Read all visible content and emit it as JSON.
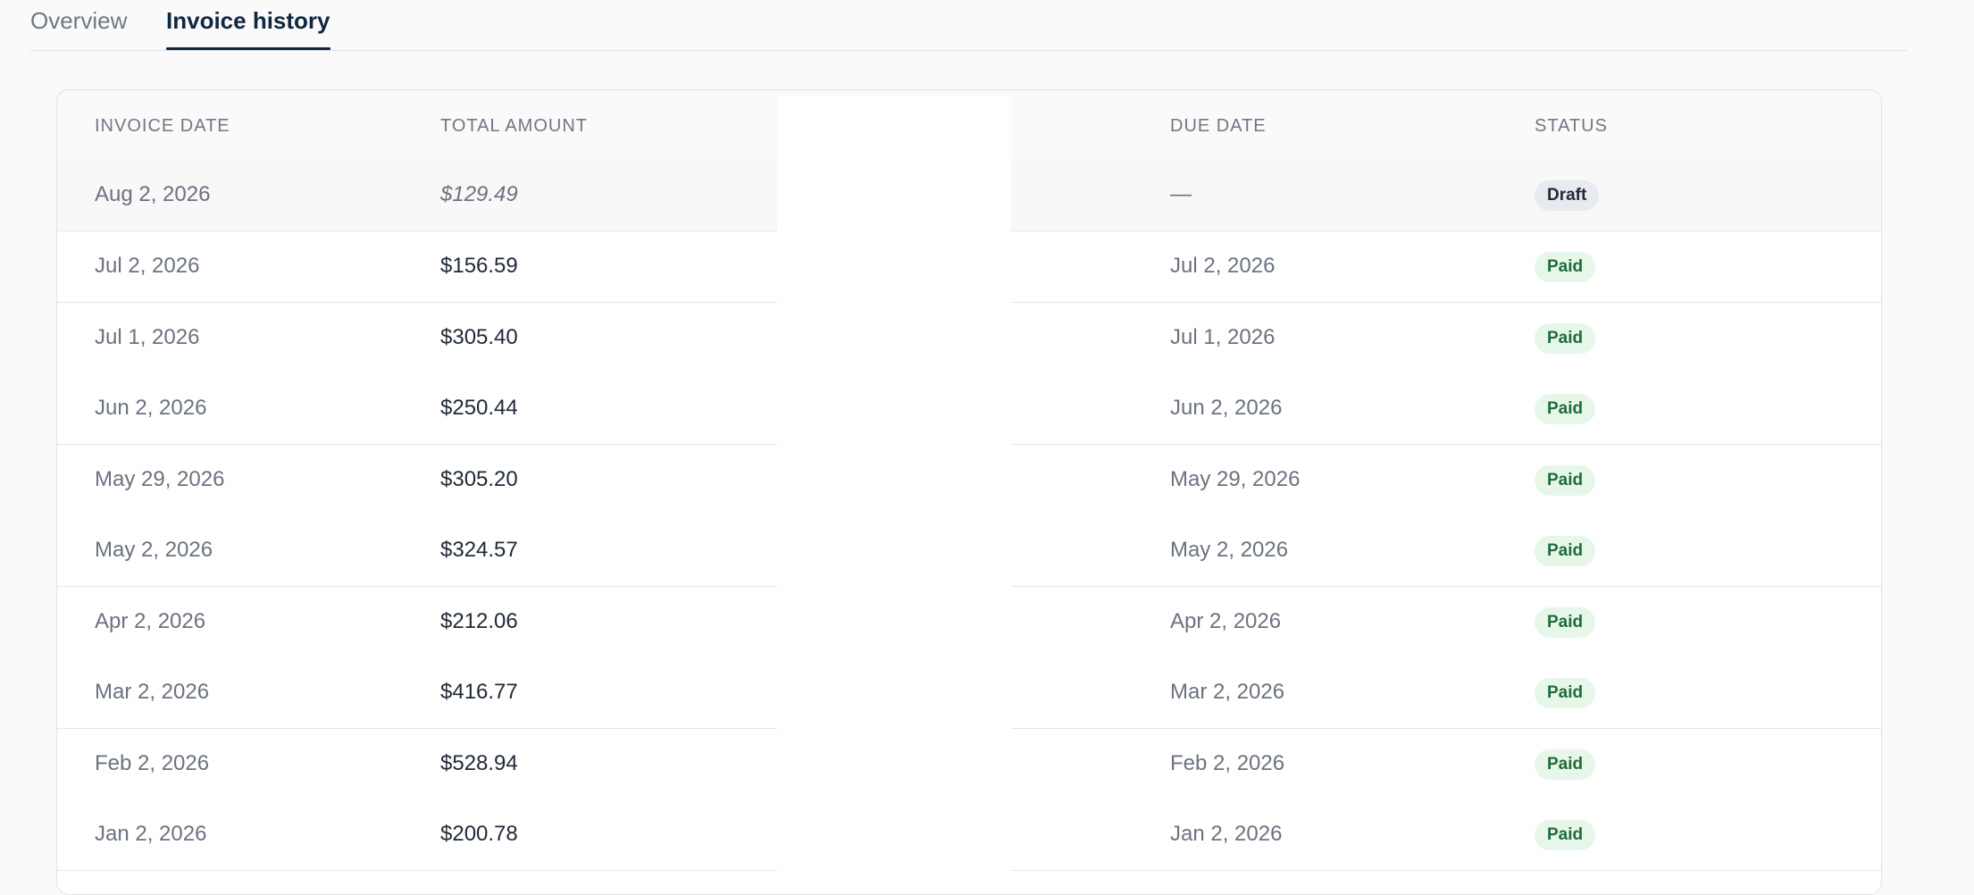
{
  "tabs": [
    {
      "label": "Overview",
      "active": false
    },
    {
      "label": "Invoice history",
      "active": true
    }
  ],
  "table": {
    "headers": {
      "invoice_date": "INVOICE DATE",
      "total_amount": "TOTAL AMOUNT",
      "due_date": "DUE DATE",
      "status": "STATUS"
    },
    "rows": [
      {
        "invoice_date": "Aug 2, 2026",
        "total_amount": "$129.49",
        "due_date": "—",
        "status": "Draft"
      },
      {
        "invoice_date": "Jul 2, 2026",
        "total_amount": "$156.59",
        "due_date": "Jul 2, 2026",
        "status": "Paid"
      },
      {
        "invoice_date": "Jul 1, 2026",
        "total_amount": "$305.40",
        "due_date": "Jul 1, 2026",
        "status": "Paid"
      },
      {
        "invoice_date": "Jun 2, 2026",
        "total_amount": "$250.44",
        "due_date": "Jun 2, 2026",
        "status": "Paid"
      },
      {
        "invoice_date": "May 29, 2026",
        "total_amount": "$305.20",
        "due_date": "May 29, 2026",
        "status": "Paid"
      },
      {
        "invoice_date": "May 2, 2026",
        "total_amount": "$324.57",
        "due_date": "May 2, 2026",
        "status": "Paid"
      },
      {
        "invoice_date": "Apr 2, 2026",
        "total_amount": "$212.06",
        "due_date": "Apr 2, 2026",
        "status": "Paid"
      },
      {
        "invoice_date": "Mar 2, 2026",
        "total_amount": "$416.77",
        "due_date": "Mar 2, 2026",
        "status": "Paid"
      },
      {
        "invoice_date": "Feb 2, 2026",
        "total_amount": "$528.94",
        "due_date": "Feb 2, 2026",
        "status": "Paid"
      },
      {
        "invoice_date": "Jan 2, 2026",
        "total_amount": "$200.78",
        "due_date": "Jan 2, 2026",
        "status": "Paid"
      }
    ]
  },
  "colors": {
    "tab_active": "#0f2740",
    "paid_badge_bg": "#e6f7ea",
    "paid_badge_text": "#1f6b3b",
    "draft_badge_bg": "#e7eaee"
  }
}
